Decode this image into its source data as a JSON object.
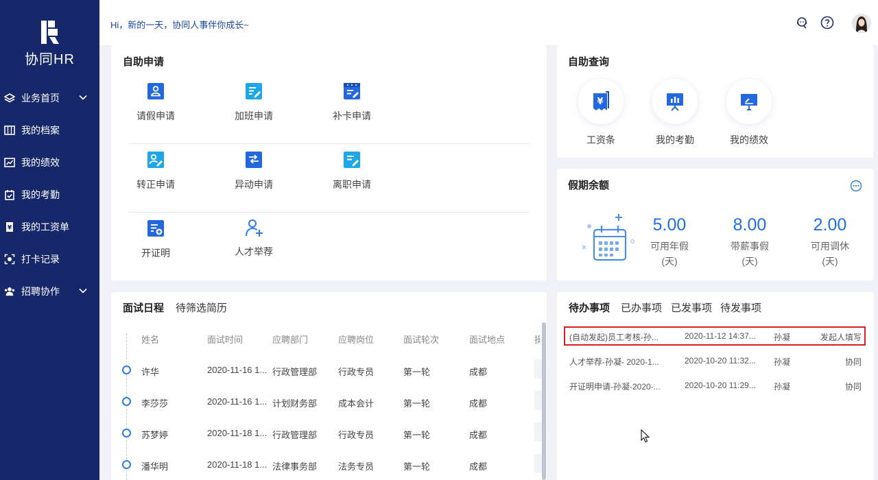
{
  "sidebar": {
    "logo_text": "协同HR",
    "items": [
      {
        "label": "业务首页",
        "icon": "layers-icon"
      },
      {
        "label": "我的档案",
        "icon": "archive-icon"
      },
      {
        "label": "我的绩效",
        "icon": "chart-icon"
      },
      {
        "label": "我的考勤",
        "icon": "calendar-check-icon"
      },
      {
        "label": "我的工资单",
        "icon": "payslip-icon"
      },
      {
        "label": "打卡记录",
        "icon": "punch-icon"
      },
      {
        "label": "招聘协作",
        "icon": "people-icon"
      }
    ]
  },
  "header": {
    "greeting": "Hi，新的一天，协同人事伴你成长~",
    "icons": [
      "support-icon",
      "help-icon",
      "avatar"
    ]
  },
  "self_apply": {
    "title": "自助申请",
    "items": [
      {
        "label": "请假申请",
        "icon": "leave-icon"
      },
      {
        "label": "加班申请",
        "icon": "overtime-icon"
      },
      {
        "label": "补卡申请",
        "icon": "patch-card-icon"
      },
      {
        "label": "转正申请",
        "icon": "regularization-icon"
      },
      {
        "label": "异动申请",
        "icon": "transfer-icon"
      },
      {
        "label": "离职申请",
        "icon": "resign-icon"
      },
      {
        "label": "开证明",
        "icon": "certificate-icon"
      },
      {
        "label": "人才举荐",
        "icon": "recommend-icon"
      }
    ]
  },
  "self_query": {
    "title": "自助查询",
    "items": [
      {
        "label": "工资条",
        "icon": "salary-slip-icon"
      },
      {
        "label": "我的考勤",
        "icon": "attendance-icon"
      },
      {
        "label": "我的绩效",
        "icon": "performance-icon"
      }
    ]
  },
  "leave_balance": {
    "title": "假期余额",
    "items": [
      {
        "value": "5.00",
        "label": "可用年假",
        "unit": "(天)"
      },
      {
        "value": "8.00",
        "label": "带薪事假",
        "unit": "(天)"
      },
      {
        "value": "2.00",
        "label": "可用调休",
        "unit": "(天)"
      }
    ]
  },
  "interview": {
    "tabs": [
      "面试日程",
      "待筛选简历"
    ],
    "columns": [
      "姓名",
      "面试时间",
      "应聘部门",
      "应聘岗位",
      "面试轮次",
      "面试地点",
      "操"
    ],
    "rows": [
      [
        "许华",
        "2020-11-16 1...",
        "行政管理部",
        "行政专员",
        "第一轮",
        "成都"
      ],
      [
        "李莎莎",
        "2020-11-16 1...",
        "计划财务部",
        "成本会计",
        "第一轮",
        "成都"
      ],
      [
        "苏梦婷",
        "2020-11-18 1...",
        "行政管理部",
        "行政专员",
        "第一轮",
        "成都"
      ],
      [
        "潘华明",
        "2020-11-18 1...",
        "法律事务部",
        "法务专员",
        "第一轮",
        "成都"
      ]
    ]
  },
  "todo": {
    "tabs": [
      "待办事项",
      "已办事项",
      "已发事项",
      "待发事项"
    ],
    "rows": [
      [
        "(自动发起)员工考核-孙...",
        "2020-11-12 14:37...",
        "孙凝",
        "发起人填写"
      ],
      [
        "人才举荐-孙凝- 2020-1...",
        "2020-10-20 11:32...",
        "孙凝",
        "协同"
      ],
      [
        "开证明申请-孙凝-2020-...",
        "2020-10-20 11:29...",
        "孙凝",
        "协同"
      ]
    ]
  },
  "colors": {
    "sidebar": "#16286a",
    "accent": "#1e6ee8",
    "highlight_border": "#d92020"
  }
}
